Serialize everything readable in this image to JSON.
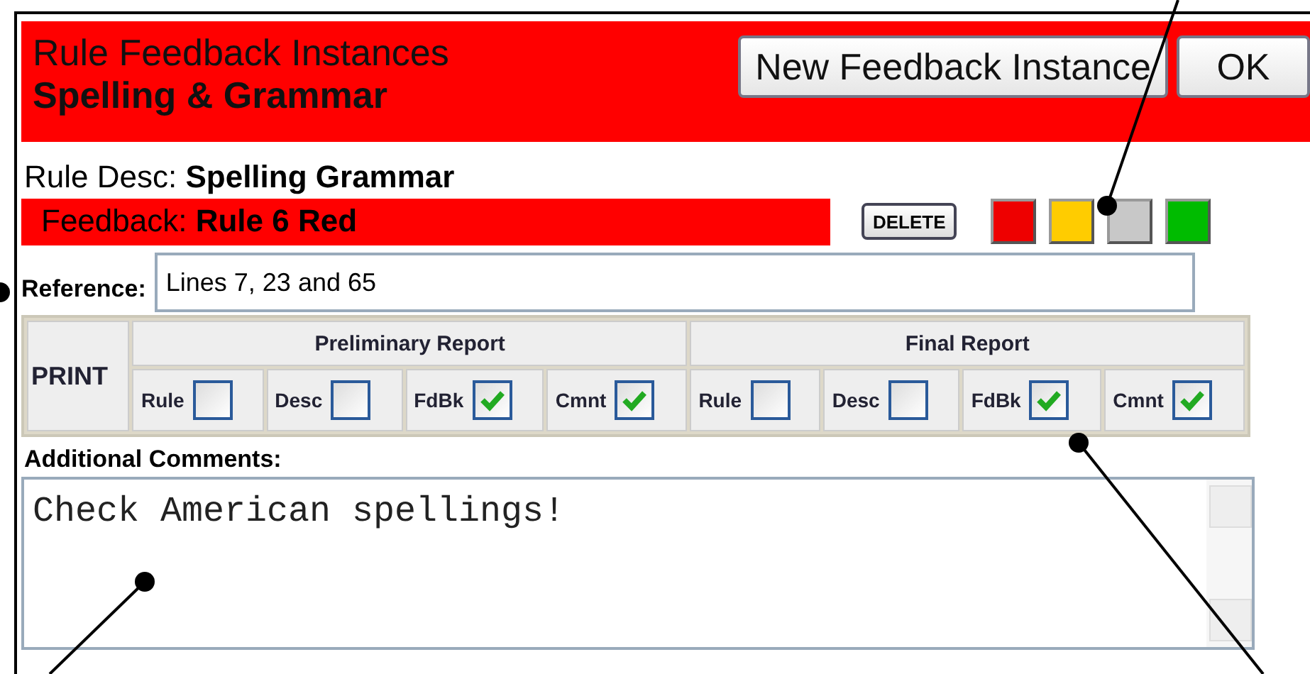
{
  "header": {
    "title": "Rule Feedback Instances",
    "subtitle": "Spelling & Grammar",
    "buttons": [
      "New Feedback Instance",
      "OK"
    ]
  },
  "rule_desc": {
    "label": "Rule Desc:",
    "value": "Spelling Grammar"
  },
  "feedback": {
    "label": "Feedback:",
    "value": "Rule 6 Red",
    "color": "#ff0000",
    "delete_button": "DELETE"
  },
  "color_swatches": [
    {
      "color": "#ee0000"
    },
    {
      "color": "#ffcc00"
    },
    {
      "color": "#c8c8c8"
    },
    {
      "color": "#00bb00"
    }
  ],
  "reference": {
    "label": "Reference:",
    "value": "Lines 7, 23 and 65"
  },
  "print_table": {
    "label": "PRINT",
    "groups": [
      {
        "title": "Preliminary Report",
        "options": [
          {
            "label": "Rule",
            "checked": false
          },
          {
            "label": "Desc",
            "checked": false
          },
          {
            "label": "FdBk",
            "checked": true
          },
          {
            "label": "Cmnt",
            "checked": true
          }
        ]
      },
      {
        "title": "Final Report",
        "options": [
          {
            "label": "Rule",
            "checked": false
          },
          {
            "label": "Desc",
            "checked": false
          },
          {
            "label": "FdBk",
            "checked": true
          },
          {
            "label": "Cmnt",
            "checked": true
          }
        ]
      }
    ]
  },
  "comments": {
    "label": "Additional Comments:",
    "value": "Check American spellings!"
  }
}
